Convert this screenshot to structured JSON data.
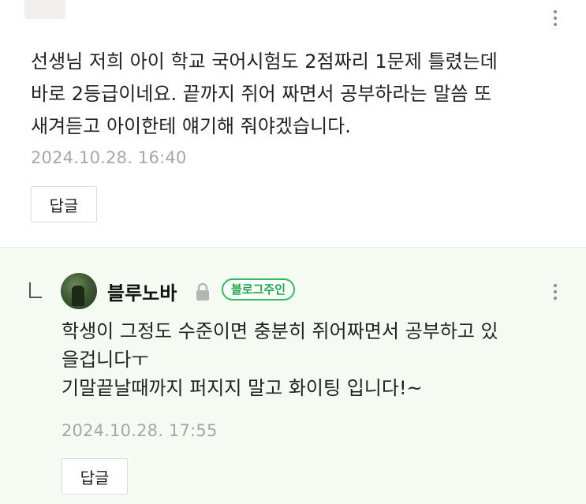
{
  "comment": {
    "lines": [
      "선생님 저희 아이 학교 국어시험도 2점짜리 1문제 틀렸는데",
      "바로 2등급이네요. 끝까지 쥐어 짜면서 공부하라는 말씀 또",
      "새겨듣고 아이한테 얘기해 줘야겠습니다."
    ],
    "timestamp": "2024.10.28. 16:40",
    "reply_label": "답글",
    "more_icon": "kebab-vertical-icon"
  },
  "reply": {
    "author": "블루노바",
    "badge": "블로그주인",
    "lock_icon": "lock-icon",
    "lines": [
      "학생이 그정도 수준이면 충분히 쥐어짜면서 공부하고 있",
      "을겁니다ㅜ",
      "기말끝날때까지 퍼지지 말고 화이팅 입니다!~"
    ],
    "timestamp": "2024.10.28. 17:55",
    "reply_label": "답글",
    "more_icon": "kebab-vertical-icon",
    "badge_color": "#2bbf5a",
    "background_color": "#f5fbf2"
  }
}
